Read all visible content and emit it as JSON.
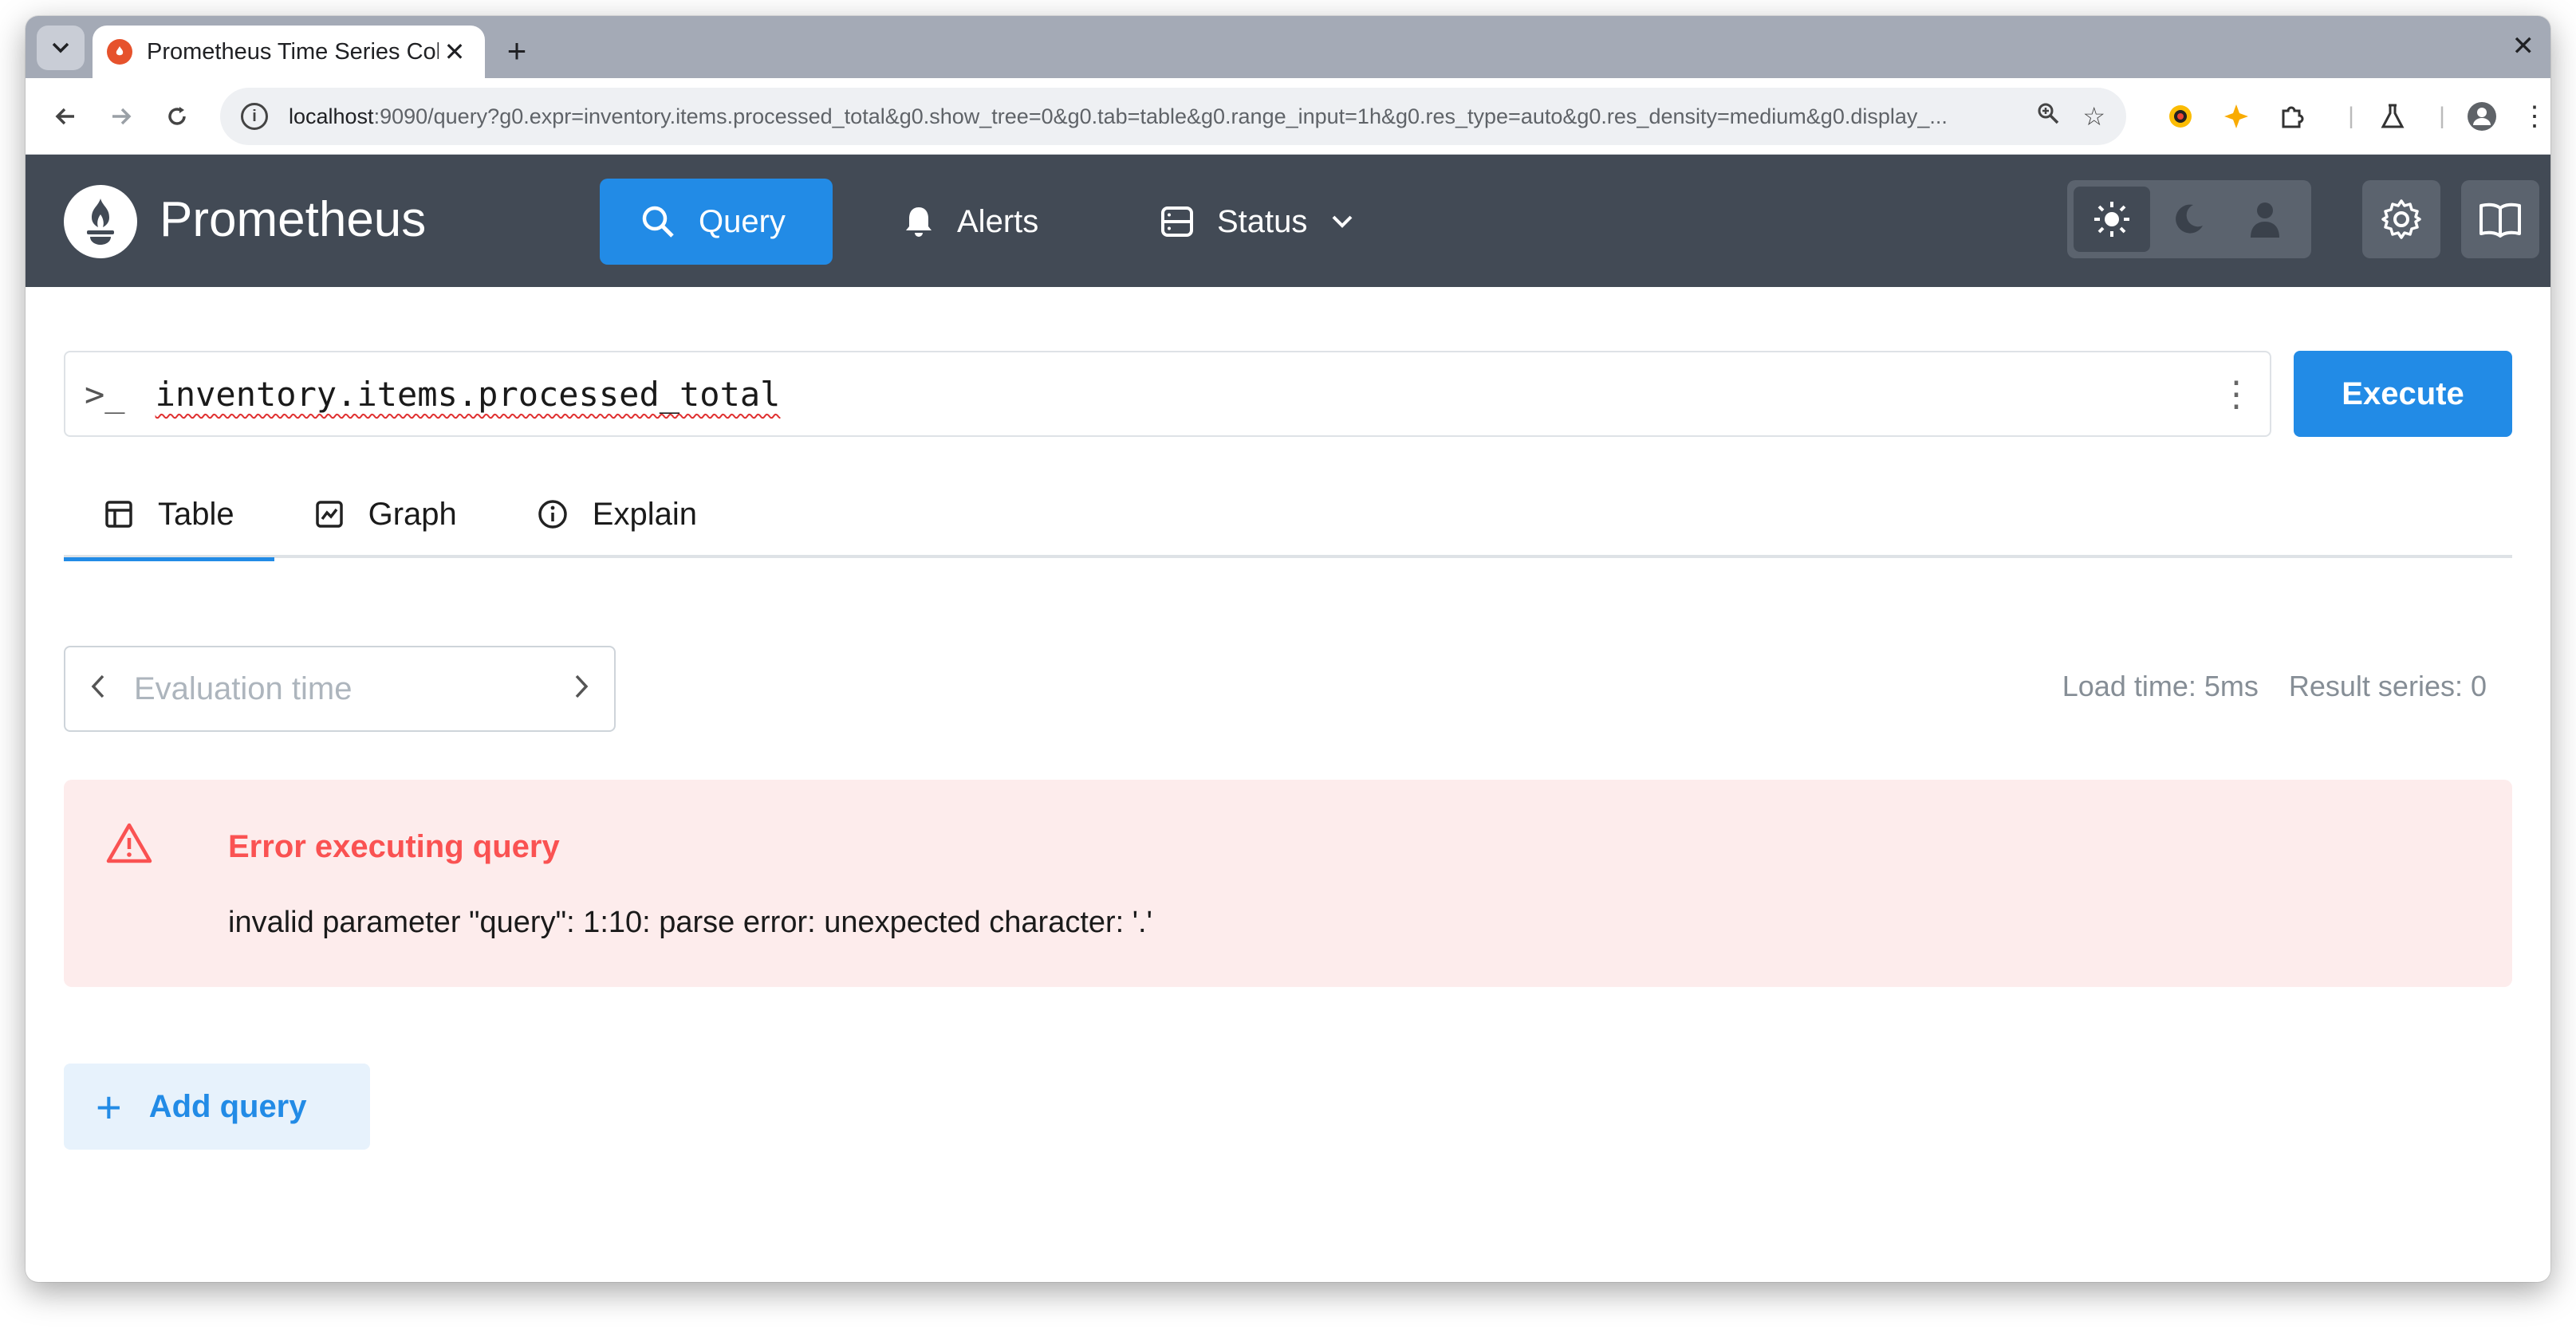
{
  "browser": {
    "tab_title": "Prometheus Time Series Collection and Processing Server",
    "url_host": "localhost",
    "url_rest": ":9090/query?g0.expr=inventory.items.processed_total&g0.show_tree=0&g0.tab=table&g0.range_input=1h&g0.res_type=auto&g0.res_density=medium&g0.display_..."
  },
  "app": {
    "brand": "Prometheus",
    "nav": [
      {
        "label": "Query",
        "icon": "search-icon",
        "active": true
      },
      {
        "label": "Alerts",
        "icon": "bell-icon",
        "active": false
      },
      {
        "label": "Status",
        "icon": "server-icon",
        "active": false
      }
    ]
  },
  "query": {
    "expression": "inventory.items.processed_total",
    "execute_label": "Execute"
  },
  "tabs": [
    {
      "label": "Table",
      "active": true
    },
    {
      "label": "Graph",
      "active": false
    },
    {
      "label": "Explain",
      "active": false
    }
  ],
  "evaluation": {
    "placeholder": "Evaluation time"
  },
  "stats": {
    "load_time": "Load time: 5ms",
    "result_series": "Result series: 0"
  },
  "error": {
    "title": "Error executing query",
    "message": "invalid parameter \"query\": 1:10: parse error: unexpected character: '.'"
  },
  "add_query_label": "Add query",
  "colors": {
    "accent": "#228be6",
    "appbar": "#424a55",
    "error_bg": "#fdecec",
    "error_text": "#fa5252"
  }
}
